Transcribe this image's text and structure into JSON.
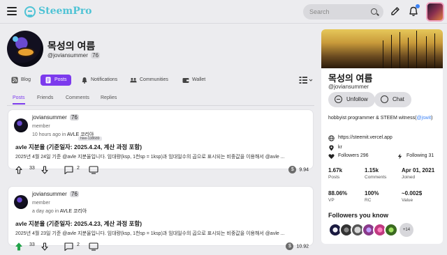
{
  "app": {
    "logo_text": "SteemPro",
    "brand_color": "#4fc3d5",
    "accent_color": "#7c3aed"
  },
  "search": {
    "placeholder": "Search"
  },
  "profile": {
    "name": "목성의 여름",
    "handle": "@joviansummer",
    "reputation": "76"
  },
  "nav": {
    "items": [
      {
        "label": "Blog",
        "icon": "rss-icon"
      },
      {
        "label": "Posts",
        "icon": "post-icon",
        "active": true
      },
      {
        "label": "Notifications",
        "icon": "bell-icon"
      },
      {
        "label": "Communities",
        "icon": "people-icon"
      },
      {
        "label": "Wallet",
        "icon": "wallet-icon"
      }
    ]
  },
  "subtabs": [
    "Posts",
    "Friends",
    "Comments",
    "Replies"
  ],
  "posts": [
    {
      "author": "joviansummer",
      "reputation": "76",
      "role": "member",
      "time": "10 hours ago in",
      "community": "AVLE 코리아",
      "tooltip": "hive-138689",
      "title": "avle 지분율 (기준일자: 2025.4.24, 계산 과정 포함)",
      "body": "2025년 4월 24일 기준 @avle 지분율입니다. 임대량(ksp, 1천sp = 1ksp)과 임대일수의 곱으로 표시되는 비중값을 이용해서 @avle ...",
      "votes": "33",
      "comments": "2",
      "payout": "9.94"
    },
    {
      "author": "joviansummer",
      "reputation": "76",
      "role": "member",
      "time": "a day ago in",
      "community": "AVLE 코리아",
      "title": "avle 지분율 (기준일자: 2025.4.23, 계산 과정 포함)",
      "body": "2025년 4월 23일 기준 @avle 지분율입니다. 임대량(ksp, 1천sp = 1ksp)과 임대일수의 곱으로 표시되는 비중값을 이용해서 @avle ...",
      "votes": "33",
      "comments": "2",
      "payout": "10.92"
    }
  ],
  "sidebar": {
    "name": "목성의 여름",
    "handle": "@joviansummer",
    "unfollow_label": "Unfollow",
    "chat_label": "Chat",
    "bio_prefix": "hobbyist programmer & STEEM witness(",
    "bio_link": "@jswit",
    "bio_suffix": ")",
    "website": "https://steemit.vercel.app",
    "location": "kr",
    "followers_label": "Followers 296",
    "following_label": "Following 31",
    "stats": [
      {
        "value": "1.67k",
        "label": "Posts"
      },
      {
        "value": "1.15k",
        "label": "Comments"
      },
      {
        "value": "Apr 01, 2021",
        "label": "Joined"
      },
      {
        "value": "88.06%",
        "label": "VP"
      },
      {
        "value": "100%",
        "label": "RC"
      },
      {
        "value": "~0.002$",
        "label": "Value"
      }
    ],
    "followers_you_know": "Followers you know",
    "more_count": "+14"
  }
}
